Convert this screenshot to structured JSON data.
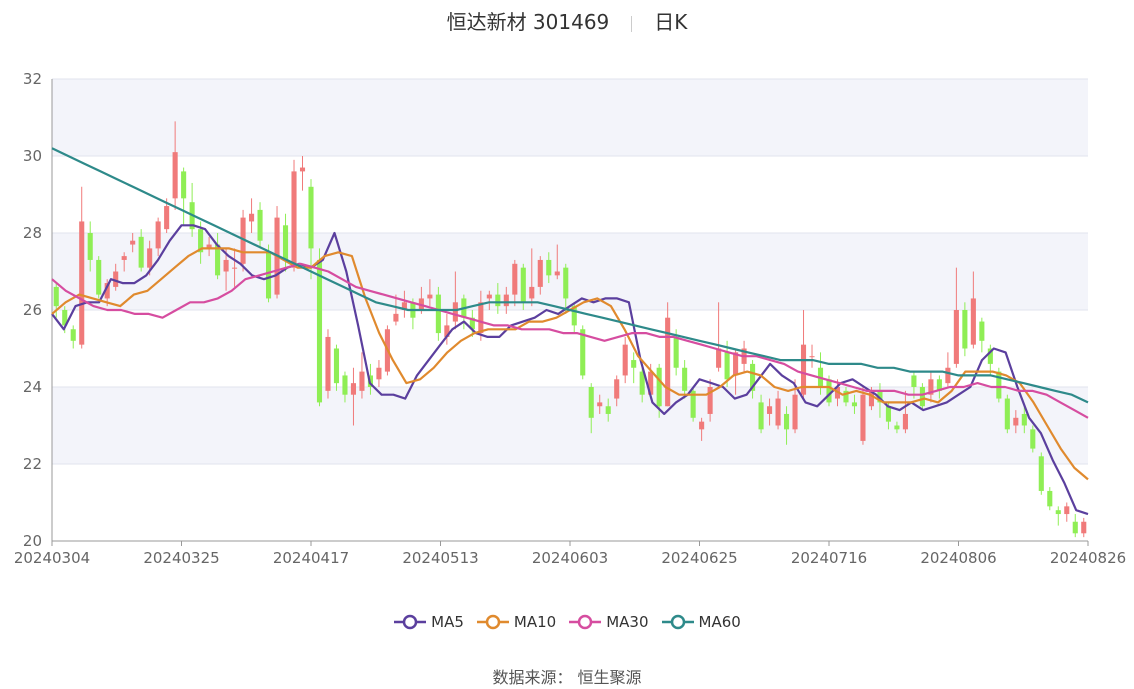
{
  "title": {
    "name": "恒达新材 301469",
    "period": "日K"
  },
  "source": {
    "label": "数据来源：",
    "value": "恒生聚源"
  },
  "legend": [
    {
      "name": "MA5",
      "color": "#5b3f9e"
    },
    {
      "name": "MA10",
      "color": "#e08a2e"
    },
    {
      "name": "MA30",
      "color": "#d64da0"
    },
    {
      "name": "MA60",
      "color": "#2e8a8a"
    }
  ],
  "chart_data": {
    "type": "candlestick",
    "ylim": [
      20,
      32
    ],
    "yticks": [
      "20",
      "22",
      "24",
      "26",
      "28",
      "30",
      "32"
    ],
    "xtick_labels": [
      "20240304",
      "20240325",
      "20240417",
      "20240513",
      "20240603",
      "20240625",
      "20240716",
      "20240806",
      "20240826"
    ],
    "up_color": "#f07a7a",
    "down_color": "#8fee55",
    "candles": [
      [
        26.6,
        26.1,
        26.7,
        25.8
      ],
      [
        26.0,
        25.6,
        26.1,
        25.4
      ],
      [
        25.5,
        25.2,
        25.6,
        25.0
      ],
      [
        25.1,
        28.3,
        29.2,
        25.0
      ],
      [
        28.0,
        27.3,
        28.3,
        27.0
      ],
      [
        27.3,
        26.4,
        27.4,
        26.3
      ],
      [
        26.3,
        26.7,
        26.8,
        26.1
      ],
      [
        26.6,
        27.0,
        27.2,
        26.5
      ],
      [
        27.3,
        27.4,
        27.5,
        27.0
      ],
      [
        27.7,
        27.8,
        28.0,
        27.5
      ],
      [
        27.9,
        27.1,
        28.1,
        27.0
      ],
      [
        27.1,
        27.6,
        27.8,
        26.9
      ],
      [
        27.6,
        28.3,
        28.4,
        27.4
      ],
      [
        28.1,
        28.7,
        28.9,
        28.0
      ],
      [
        28.9,
        30.1,
        30.9,
        28.6
      ],
      [
        29.6,
        28.9,
        29.7,
        28.2
      ],
      [
        28.8,
        28.1,
        29.3,
        27.9
      ],
      [
        28.1,
        27.5,
        28.3,
        27.2
      ],
      [
        27.6,
        27.7,
        27.9,
        27.4
      ],
      [
        27.7,
        26.9,
        28.0,
        26.8
      ],
      [
        27.0,
        27.3,
        27.6,
        26.5
      ],
      [
        27.1,
        27.1,
        27.6,
        26.6
      ],
      [
        27.2,
        28.4,
        28.6,
        27.0
      ],
      [
        28.3,
        28.5,
        28.9,
        28.0
      ],
      [
        28.6,
        27.8,
        28.8,
        27.6
      ],
      [
        27.5,
        26.3,
        27.7,
        26.2
      ],
      [
        26.4,
        28.4,
        28.7,
        26.3
      ],
      [
        28.2,
        27.3,
        28.5,
        27.0
      ],
      [
        27.1,
        29.6,
        29.9,
        27.0
      ],
      [
        29.6,
        29.7,
        30.0,
        29.1
      ],
      [
        29.2,
        27.6,
        29.4,
        26.8
      ],
      [
        27.3,
        23.6,
        27.6,
        23.5
      ],
      [
        23.9,
        25.3,
        25.5,
        23.7
      ],
      [
        25.0,
        24.1,
        25.1,
        23.9
      ],
      [
        24.3,
        23.8,
        24.4,
        23.6
      ],
      [
        23.8,
        24.1,
        24.5,
        23.0
      ],
      [
        23.9,
        24.4,
        24.9,
        23.7
      ],
      [
        24.3,
        24.0,
        24.6,
        23.8
      ],
      [
        24.2,
        24.5,
        24.7,
        24.0
      ],
      [
        24.4,
        25.5,
        25.6,
        24.3
      ],
      [
        25.7,
        25.9,
        26.4,
        25.6
      ],
      [
        26.0,
        26.2,
        26.5,
        25.8
      ],
      [
        26.2,
        25.8,
        26.3,
        25.5
      ],
      [
        26.0,
        26.3,
        26.6,
        25.9
      ],
      [
        26.3,
        26.4,
        26.8,
        26.1
      ],
      [
        26.4,
        25.4,
        26.6,
        25.2
      ],
      [
        25.3,
        25.6,
        25.9,
        25.1
      ],
      [
        25.7,
        26.2,
        27.0,
        25.5
      ],
      [
        26.3,
        25.8,
        26.4,
        25.5
      ],
      [
        25.8,
        25.5,
        26.0,
        25.3
      ],
      [
        25.4,
        26.2,
        26.5,
        25.2
      ],
      [
        26.3,
        26.4,
        26.5,
        26.0
      ],
      [
        26.4,
        26.1,
        26.7,
        25.9
      ],
      [
        26.1,
        26.4,
        26.6,
        25.9
      ],
      [
        26.4,
        27.2,
        27.3,
        26.1
      ],
      [
        27.1,
        26.2,
        27.2,
        26.0
      ],
      [
        26.3,
        26.6,
        27.6,
        26.1
      ],
      [
        26.6,
        27.3,
        27.4,
        26.4
      ],
      [
        27.3,
        26.9,
        27.5,
        26.7
      ],
      [
        26.9,
        27.0,
        27.7,
        26.8
      ],
      [
        27.1,
        26.3,
        27.2,
        25.9
      ],
      [
        26.1,
        25.6,
        26.2,
        25.4
      ],
      [
        25.5,
        24.3,
        25.6,
        24.2
      ],
      [
        24.0,
        23.2,
        24.1,
        22.8
      ],
      [
        23.5,
        23.6,
        23.8,
        23.3
      ],
      [
        23.5,
        23.3,
        23.7,
        23.1
      ],
      [
        23.7,
        24.2,
        24.3,
        23.5
      ],
      [
        24.3,
        25.1,
        25.3,
        24.1
      ],
      [
        24.7,
        24.5,
        24.9,
        24.1
      ],
      [
        24.4,
        23.8,
        24.6,
        23.6
      ],
      [
        23.8,
        24.4,
        24.6,
        23.7
      ],
      [
        24.5,
        23.5,
        24.6,
        23.2
      ],
      [
        23.5,
        25.8,
        26.2,
        23.5
      ],
      [
        25.3,
        24.5,
        25.5,
        24.3
      ],
      [
        24.5,
        23.9,
        24.7,
        23.7
      ],
      [
        23.9,
        23.2,
        24.0,
        23.1
      ],
      [
        22.9,
        23.1,
        23.2,
        22.6
      ],
      [
        23.3,
        24.0,
        24.2,
        23.1
      ],
      [
        24.5,
        25.0,
        26.2,
        24.4
      ],
      [
        24.9,
        24.2,
        25.2,
        24.0
      ],
      [
        24.3,
        24.9,
        25.0,
        23.8
      ],
      [
        24.6,
        25.0,
        25.2,
        24.4
      ],
      [
        24.6,
        23.9,
        24.7,
        23.7
      ],
      [
        23.6,
        22.9,
        23.8,
        22.8
      ],
      [
        23.3,
        23.5,
        23.7,
        23.0
      ],
      [
        23.0,
        23.7,
        23.9,
        22.9
      ],
      [
        23.3,
        22.9,
        23.5,
        22.5
      ],
      [
        22.9,
        23.8,
        24.2,
        22.8
      ],
      [
        23.8,
        25.1,
        26.0,
        23.7
      ],
      [
        24.8,
        24.8,
        25.1,
        24.5
      ],
      [
        24.5,
        24.0,
        24.9,
        23.8
      ],
      [
        24.2,
        23.6,
        24.3,
        23.5
      ],
      [
        23.7,
        24.0,
        24.2,
        23.5
      ],
      [
        23.9,
        23.6,
        24.0,
        23.5
      ],
      [
        23.6,
        23.5,
        23.8,
        23.3
      ],
      [
        22.6,
        23.8,
        24.0,
        22.5
      ],
      [
        23.5,
        23.9,
        24.0,
        23.4
      ],
      [
        23.9,
        23.6,
        24.1,
        23.2
      ],
      [
        23.5,
        23.1,
        23.6,
        22.9
      ],
      [
        23.0,
        22.9,
        23.1,
        22.8
      ],
      [
        22.9,
        23.3,
        23.9,
        22.8
      ],
      [
        24.3,
        24.0,
        24.4,
        23.7
      ],
      [
        24.0,
        23.5,
        24.1,
        23.4
      ],
      [
        23.8,
        24.2,
        24.4,
        23.6
      ],
      [
        24.2,
        23.9,
        24.3,
        23.7
      ],
      [
        24.1,
        24.5,
        24.9,
        24.0
      ],
      [
        24.6,
        26.0,
        27.1,
        24.5
      ],
      [
        26.0,
        25.0,
        26.2,
        24.8
      ],
      [
        25.1,
        26.3,
        27.0,
        25.0
      ],
      [
        25.7,
        25.2,
        25.8,
        24.9
      ],
      [
        25.0,
        24.6,
        25.1,
        24.3
      ],
      [
        24.4,
        23.7,
        24.5,
        23.6
      ],
      [
        23.7,
        22.9,
        23.8,
        22.8
      ],
      [
        23.0,
        23.2,
        23.4,
        22.8
      ],
      [
        23.3,
        23.0,
        23.5,
        22.8
      ],
      [
        22.9,
        22.4,
        23.0,
        22.3
      ],
      [
        22.2,
        21.3,
        22.3,
        21.2
      ],
      [
        21.3,
        20.9,
        21.4,
        20.8
      ],
      [
        20.8,
        20.7,
        20.9,
        20.4
      ],
      [
        20.7,
        20.9,
        21.0,
        20.5
      ],
      [
        20.5,
        20.2,
        20.7,
        20.1
      ],
      [
        20.2,
        20.5,
        20.6,
        20.1
      ]
    ],
    "series": [
      {
        "name": "MA5",
        "values": [
          25.9,
          25.5,
          26.1,
          26.2,
          26.2,
          26.8,
          26.7,
          26.7,
          26.9,
          27.3,
          27.8,
          28.2,
          28.2,
          28.1,
          27.7,
          27.4,
          27.2,
          26.9,
          26.8,
          26.9,
          27.1,
          27.2,
          27.1,
          27.3,
          28.0,
          27.0,
          25.6,
          24.1,
          23.8,
          23.8,
          23.7,
          24.3,
          24.7,
          25.1,
          25.5,
          25.7,
          25.4,
          25.3,
          25.3,
          25.6,
          25.7,
          25.8,
          26.0,
          25.9,
          26.1,
          26.3,
          26.2,
          26.3,
          26.3,
          26.2,
          24.7,
          23.6,
          23.3,
          23.6,
          23.8,
          24.2,
          24.1,
          24.0,
          23.7,
          23.8,
          24.2,
          24.6,
          24.3,
          24.1,
          23.6,
          23.5,
          23.8,
          24.1,
          24.2,
          24.0,
          23.8,
          23.5,
          23.4,
          23.6,
          23.4,
          23.5,
          23.6,
          23.8,
          24.0,
          24.7,
          25.0,
          24.9,
          24.0,
          23.2,
          22.8,
          22.1,
          21.5,
          20.8,
          20.7
        ],
        "x_frac_step": true
      },
      {
        "name": "MA10",
        "values": [
          25.9,
          26.2,
          26.4,
          26.3,
          26.2,
          26.1,
          26.4,
          26.5,
          26.8,
          27.1,
          27.4,
          27.6,
          27.6,
          27.6,
          27.5,
          27.5,
          27.5,
          27.3,
          27.1,
          27.1,
          27.4,
          27.5,
          27.4,
          26.3,
          25.4,
          24.7,
          24.1,
          24.2,
          24.5,
          24.9,
          25.2,
          25.4,
          25.5,
          25.5,
          25.5,
          25.7,
          25.7,
          25.8,
          26.0,
          26.2,
          26.3,
          26.1,
          25.5,
          24.8,
          24.4,
          24.0,
          23.8,
          23.8,
          23.8,
          24.0,
          24.3,
          24.4,
          24.3,
          24.0,
          23.9,
          24.0,
          24.0,
          24.0,
          23.8,
          23.9,
          23.8,
          23.6,
          23.6,
          23.6,
          23.7,
          23.6,
          23.9,
          24.4,
          24.4,
          24.4,
          24.3,
          24.1,
          23.6,
          23.0,
          22.4,
          21.9,
          21.6
        ]
      },
      {
        "name": "MA30",
        "values": [
          26.8,
          26.5,
          26.3,
          26.1,
          26.0,
          26.0,
          25.9,
          25.9,
          25.8,
          26.0,
          26.2,
          26.2,
          26.3,
          26.5,
          26.8,
          26.9,
          27.0,
          27.1,
          27.2,
          27.1,
          27.0,
          26.8,
          26.6,
          26.5,
          26.4,
          26.3,
          26.2,
          26.1,
          26.0,
          25.9,
          25.8,
          25.7,
          25.6,
          25.6,
          25.5,
          25.5,
          25.5,
          25.4,
          25.4,
          25.3,
          25.2,
          25.3,
          25.4,
          25.4,
          25.3,
          25.3,
          25.2,
          25.1,
          25.0,
          24.9,
          24.8,
          24.8,
          24.7,
          24.6,
          24.4,
          24.3,
          24.2,
          24.1,
          24.0,
          23.9,
          23.9,
          23.9,
          23.8,
          23.8,
          23.9,
          24.0,
          24.0,
          24.1,
          24.0,
          24.0,
          23.9,
          23.9,
          23.8,
          23.6,
          23.4,
          23.2
        ]
      },
      {
        "name": "MA60",
        "values": [
          30.2,
          30.0,
          29.8,
          29.6,
          29.4,
          29.2,
          29.0,
          28.8,
          28.6,
          28.4,
          28.2,
          28.0,
          27.8,
          27.6,
          27.4,
          27.2,
          27.0,
          26.8,
          26.6,
          26.4,
          26.2,
          26.1,
          26.0,
          26.0,
          26.0,
          26.0,
          26.1,
          26.2,
          26.2,
          26.2,
          26.2,
          26.1,
          26.0,
          25.9,
          25.8,
          25.7,
          25.6,
          25.5,
          25.4,
          25.3,
          25.2,
          25.1,
          25.0,
          24.9,
          24.8,
          24.7,
          24.7,
          24.7,
          24.6,
          24.6,
          24.6,
          24.5,
          24.5,
          24.4,
          24.4,
          24.4,
          24.3,
          24.3,
          24.3,
          24.2,
          24.1,
          24.0,
          23.9,
          23.8,
          23.6
        ]
      }
    ]
  }
}
